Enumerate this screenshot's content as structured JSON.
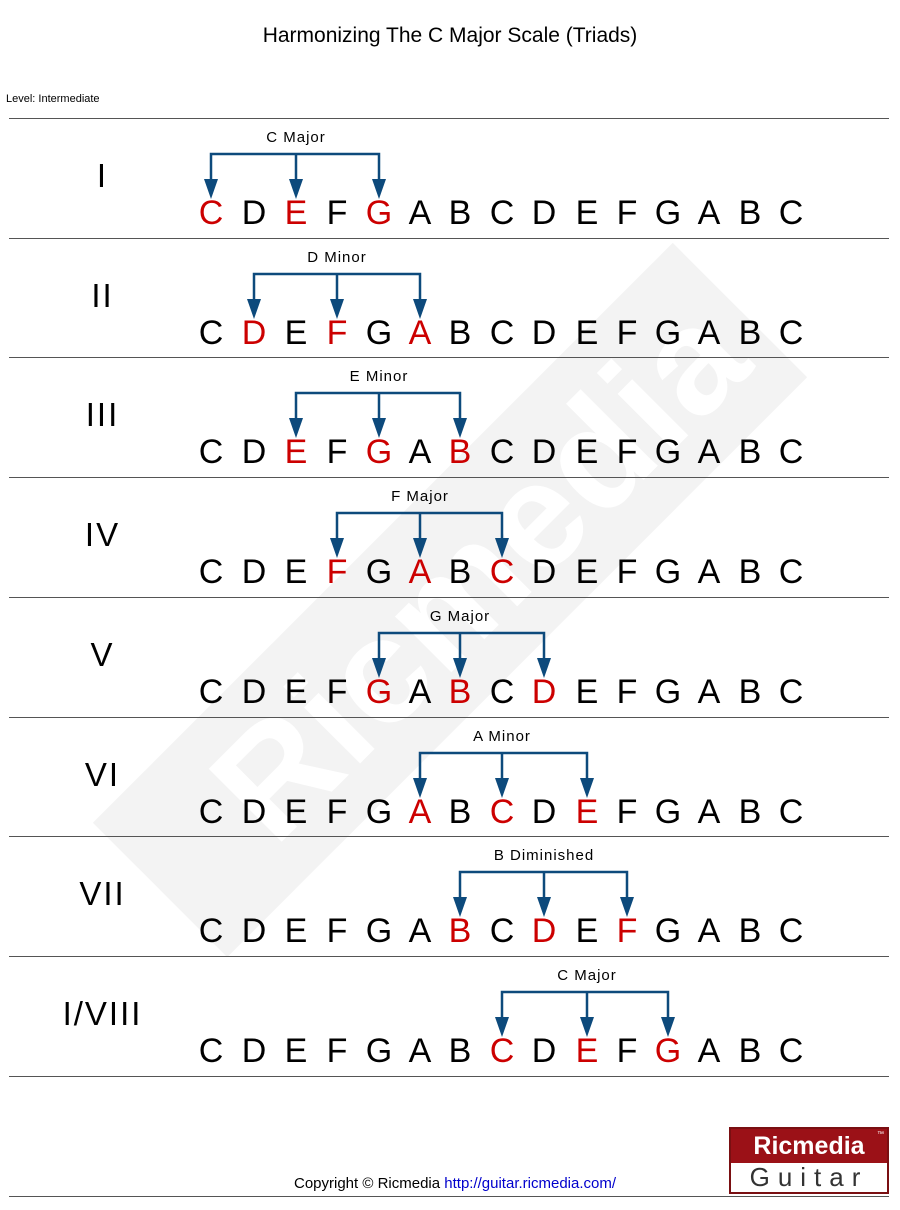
{
  "title": "Harmonizing The C Major Scale (Triads)",
  "level": "Level: Intermediate",
  "watermark": "Ricmedia",
  "watermark_tm": "™",
  "scale_notes": [
    "C",
    "D",
    "E",
    "F",
    "G",
    "A",
    "B",
    "C",
    "D",
    "E",
    "F",
    "G",
    "A",
    "B",
    "C"
  ],
  "rows": [
    {
      "numeral": "I",
      "chord": "C Major",
      "highlight": [
        0,
        2,
        4
      ]
    },
    {
      "numeral": "II",
      "chord": "D Minor",
      "highlight": [
        1,
        3,
        5
      ]
    },
    {
      "numeral": "III",
      "chord": "E Minor",
      "highlight": [
        2,
        4,
        6
      ]
    },
    {
      "numeral": "IV",
      "chord": "F Major",
      "highlight": [
        3,
        5,
        7
      ]
    },
    {
      "numeral": "V",
      "chord": "G Major",
      "highlight": [
        4,
        6,
        8
      ]
    },
    {
      "numeral": "VI",
      "chord": "A Minor",
      "highlight": [
        5,
        7,
        9
      ]
    },
    {
      "numeral": "VII",
      "chord": "B Diminished",
      "highlight": [
        6,
        8,
        10
      ]
    },
    {
      "numeral": "I/VIII",
      "chord": "C Major",
      "highlight": [
        7,
        9,
        11
      ]
    }
  ],
  "footer": {
    "copyright": "Copyright © Ricmedia",
    "link": "http://guitar.ricmedia.com/"
  },
  "logo": {
    "top": "Ricmedia",
    "bottom": "Guitar",
    "tm": "™"
  },
  "colors": {
    "highlight": "#cc0000",
    "arrow": "#0d4a7c",
    "logo": "#9b1117"
  }
}
